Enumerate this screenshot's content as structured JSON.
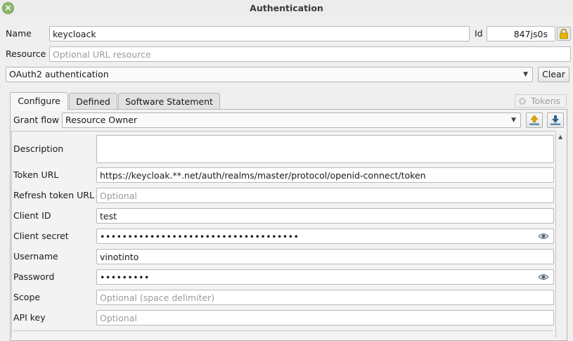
{
  "window": {
    "title": "Authentication",
    "close_glyph": "×"
  },
  "top": {
    "name_label": "Name",
    "name_value": "keycloack",
    "id_label": "Id",
    "id_value": "847js0s",
    "resource_label": "Resource",
    "resource_placeholder": "Optional URL resource",
    "method_selected": "OAuth2 authentication",
    "clear_label": "Clear"
  },
  "tabs": {
    "items": [
      {
        "label": "Configure",
        "active": true
      },
      {
        "label": "Defined",
        "active": false
      },
      {
        "label": "Software Statement",
        "active": false
      }
    ],
    "tokens_label": "Tokens"
  },
  "config": {
    "grant_flow_label": "Grant flow",
    "grant_flow_value": "Resource Owner",
    "description_label": "Description",
    "description_value": "",
    "token_url_label": "Token URL",
    "token_url_value": "https://keycloak.**.net/auth/realms/master/protocol/openid-connect/token",
    "refresh_token_url_label": "Refresh token URL",
    "refresh_token_url_placeholder": "Optional",
    "client_id_label": "Client ID",
    "client_id_value": "test",
    "client_secret_label": "Client secret",
    "client_secret_value": "••••••••••••••••••••••••••••••••••••",
    "username_label": "Username",
    "username_value": "vinotinto",
    "password_label": "Password",
    "password_value": "•••••••••",
    "scope_label": "Scope",
    "scope_placeholder": "Optional (space delimiter)",
    "api_key_label": "API key",
    "api_key_placeholder": "Optional"
  },
  "icons": {
    "close": "close-icon",
    "lock": "lock-icon",
    "dropdown": "chevron-down-icon",
    "tokens_clear": "circle-x-icon",
    "export": "export-icon",
    "import": "import-icon",
    "show_password": "eye-icon",
    "scroll_up": "scroll-up-icon"
  },
  "colors": {
    "window_bg": "#efefef",
    "close_button": "#8dba6b",
    "lock_body": "#e3b400",
    "arrow_accent": "#e0a800",
    "placeholder": "#9a9a9a"
  }
}
